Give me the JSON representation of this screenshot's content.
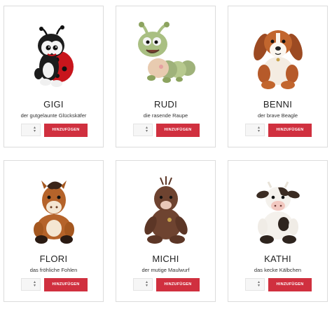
{
  "products": [
    {
      "name": "GIGI",
      "tagline": "der gutgelaunte Glückskäfer",
      "button": "HINZUFÜGEN",
      "icon": "ladybug-plush-icon"
    },
    {
      "name": "RUDI",
      "tagline": "die rasende Raupe",
      "button": "HINZUFÜGEN",
      "icon": "caterpillar-plush-icon"
    },
    {
      "name": "BENNI",
      "tagline": "der brave Beagle",
      "button": "HINZUFÜGEN",
      "icon": "beagle-plush-icon"
    },
    {
      "name": "FLORI",
      "tagline": "das fröhliche Fohlen",
      "button": "HINZUFÜGEN",
      "icon": "foal-plush-icon"
    },
    {
      "name": "MICHI",
      "tagline": "der mutige Maulwurf",
      "button": "HINZUFÜGEN",
      "icon": "mole-plush-icon"
    },
    {
      "name": "KATHI",
      "tagline": "das kecke Kälbchen",
      "button": "HINZUFÜGEN",
      "icon": "calf-plush-icon"
    }
  ],
  "colors": {
    "button": "#d0303f",
    "border": "#dcdcdc"
  }
}
